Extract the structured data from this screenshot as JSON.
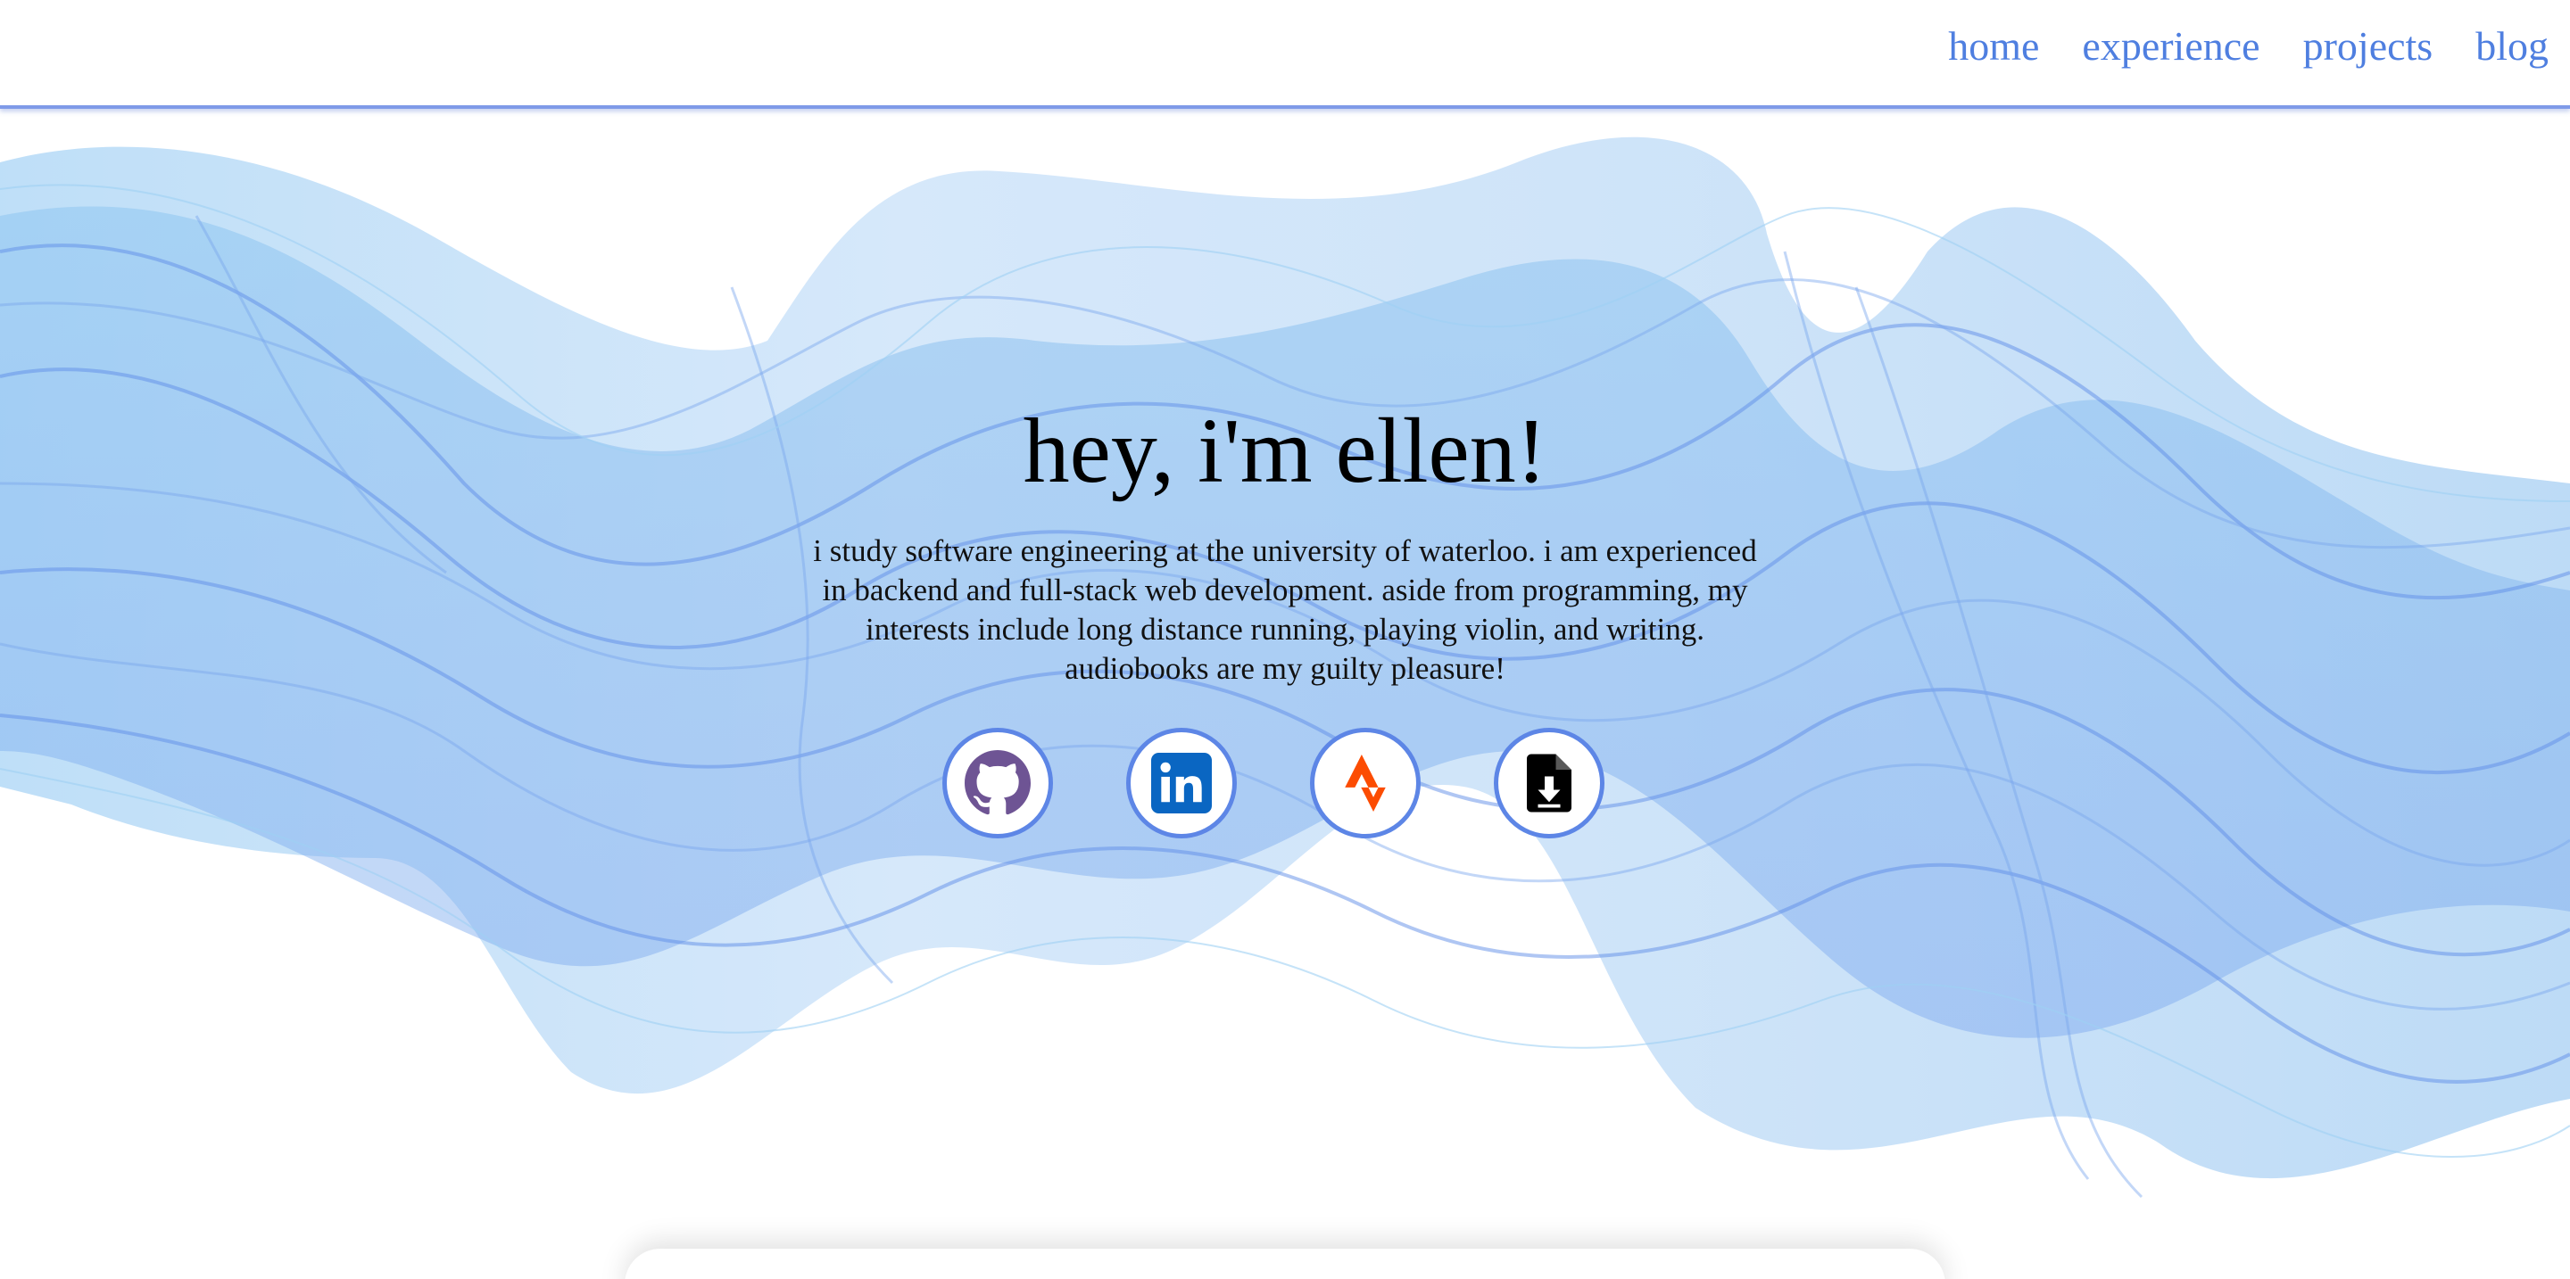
{
  "nav": {
    "items": [
      {
        "label": "home"
      },
      {
        "label": "experience"
      },
      {
        "label": "projects"
      },
      {
        "label": "blog"
      }
    ]
  },
  "hero": {
    "title": "hey, i'm ellen!",
    "intro": "i study software engineering at the university of waterloo. i am experienced in backend and full-stack web development. aside from programming, my interests include long distance running, playing violin, and writing. audiobooks are my guilty pleasure!"
  },
  "socials": [
    {
      "icon": "github-icon",
      "color": "#6e5494"
    },
    {
      "icon": "linkedin-icon",
      "color": "#0a66c2"
    },
    {
      "icon": "strava-icon",
      "color": "#fc4c02"
    },
    {
      "icon": "resume-download-icon",
      "color": "#000000"
    }
  ],
  "theme": {
    "accent": "#5d86e6",
    "nav_link": "#4f7fe0",
    "wave_light": "#bfe0f7",
    "wave_dark": "#5f8ee8"
  }
}
